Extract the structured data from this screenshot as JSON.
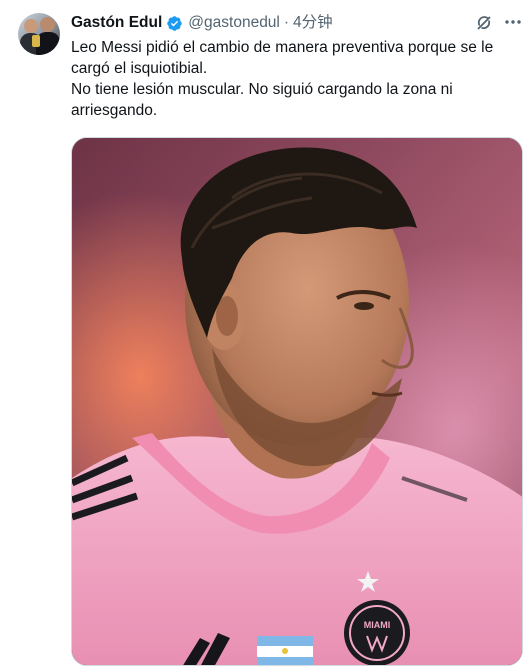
{
  "tweet": {
    "author_name": "Gastón Edul",
    "author_handle": "@gastonedul",
    "separator": "·",
    "time": "4分钟",
    "lines": [
      "Leo Messi pidió el cambio de manera preventiva porque se le cargó el isquiotibial.",
      "No tiene lesión muscular. No siguió cargando la zona ni arriesgando."
    ],
    "icons": {
      "verified": "verified-badge-icon",
      "grok": "grok-icon",
      "more": "more-options-icon"
    },
    "media": {
      "kind": "photo",
      "badge_text": [
        "MIAMI"
      ]
    }
  },
  "colors": {
    "text": "#0f1419",
    "secondary": "#536471",
    "verified": "#1d9bf0",
    "jersey_pink": "#f2a9c4"
  }
}
